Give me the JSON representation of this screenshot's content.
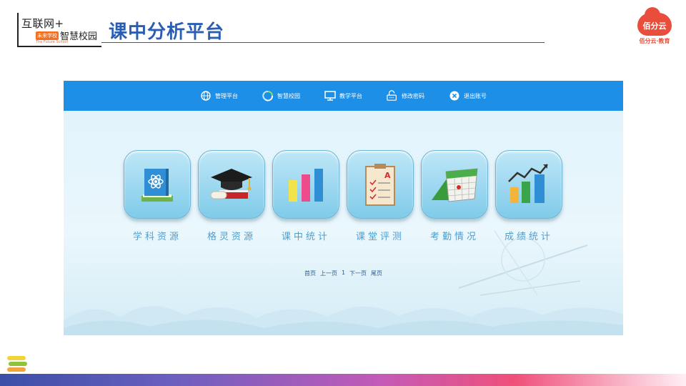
{
  "header": {
    "logo_line1": "互联网+",
    "logo_tag": "未来学校",
    "logo_line2": "智慧校园",
    "logo_english": "The Future School",
    "title": "课中分析平台",
    "brand_mark": "佰分云",
    "brand_label": "佰分云·教育"
  },
  "nav": [
    {
      "label": "管理平台",
      "icon": "globe-icon"
    },
    {
      "label": "智慧校园",
      "icon": "recycle-icon"
    },
    {
      "label": "教学平台",
      "icon": "monitor-icon"
    },
    {
      "label": "修改密码",
      "icon": "lock-icon"
    },
    {
      "label": "退出账号",
      "icon": "close-circle-icon"
    }
  ],
  "tiles": [
    {
      "label": "学科资源",
      "icon": "atom-book-icon"
    },
    {
      "label": "格灵资源",
      "icon": "graduation-cap-icon"
    },
    {
      "label": "课中统计",
      "icon": "bar-chart-icon"
    },
    {
      "label": "课堂评测",
      "icon": "checklist-icon"
    },
    {
      "label": "考勤情况",
      "icon": "calendar-icon"
    },
    {
      "label": "成绩统计",
      "icon": "trend-chart-icon"
    }
  ],
  "pager": {
    "first": "首页",
    "prev": "上一页",
    "current": "1",
    "next": "下一页",
    "last": "尾页"
  },
  "colors": {
    "topbar": "#1e8fe6",
    "title": "#2b5eb3",
    "tile_label": "#4f9fd0",
    "brand": "#e94e3c"
  }
}
